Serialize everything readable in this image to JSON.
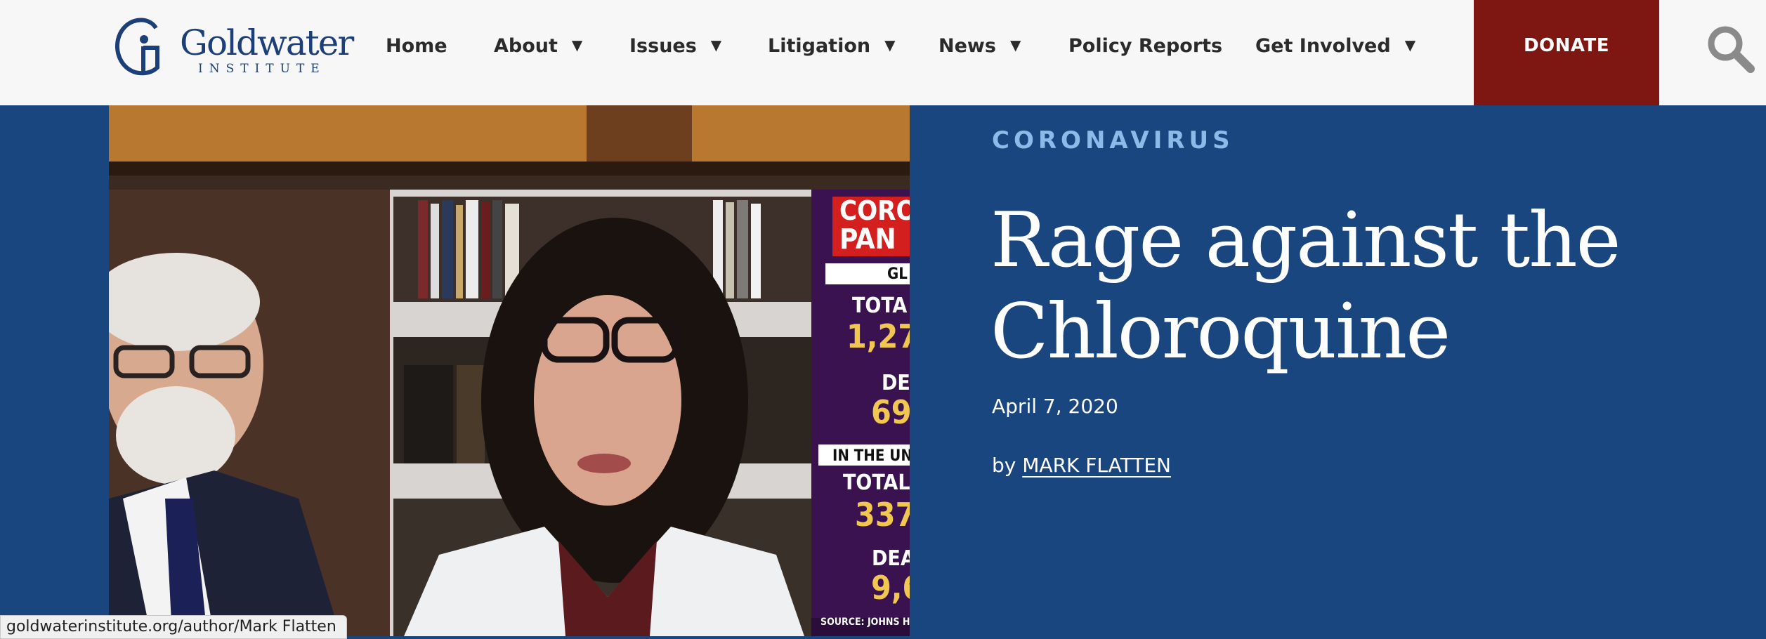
{
  "header": {
    "logo": {
      "wordmark": "Goldwater",
      "subtitle": "INSTITUTE"
    },
    "nav": [
      {
        "label": "Home",
        "dropdown": false
      },
      {
        "label": "About",
        "dropdown": true
      },
      {
        "label": "Issues",
        "dropdown": true
      },
      {
        "label": "Litigation",
        "dropdown": true
      },
      {
        "label": "News",
        "dropdown": true
      },
      {
        "label": "Policy Reports",
        "dropdown": false
      },
      {
        "label": "Get Involved",
        "dropdown": true
      }
    ],
    "caret": "▼",
    "donate_label": "DONATE",
    "search_icon": "search-icon"
  },
  "hero": {
    "category": "CORONAVIRUS",
    "title_line1": "Rage against the",
    "title_line2": "Chloroquine",
    "date": "April 7, 2020",
    "by_prefix": "by",
    "author": "MARK FLATTEN",
    "image": {
      "tv_text": {
        "banner1": "CORO",
        "banner2": "PAN",
        "gl": "GL",
        "total": "TOTA",
        "total_value": "1,27",
        "deaths": "DE",
        "deaths_value": "69",
        "in_the_us": "IN THE UN",
        "us_total": "TOTAL",
        "us_total_value": "337",
        "us_deaths": "DEA",
        "us_deaths_value": "9,6",
        "source": "SOURCE: JOHNS H"
      }
    }
  },
  "statusbar": {
    "url": "goldwaterinstitute.org/author/Mark Flatten"
  },
  "colors": {
    "brand_blue": "#1a4680",
    "donate_red": "#7e1611",
    "category_blue": "#8cbbea",
    "logo_blue": "#1d3f79"
  }
}
